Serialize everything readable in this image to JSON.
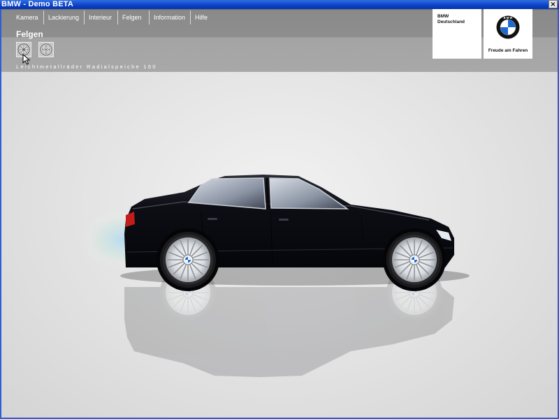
{
  "window": {
    "title": "BMW - Demo BETA",
    "close_glyph": "×"
  },
  "menu": {
    "items": [
      "Kamera",
      "Lackierung",
      "Interieur",
      "Felgen",
      "Information",
      "Hilfe"
    ]
  },
  "section": {
    "title": "Felgen"
  },
  "rims": {
    "options": [
      {
        "icon": "radial-spoke-wheel-icon",
        "selected": true
      },
      {
        "icon": "multi-spoke-wheel-icon",
        "selected": false
      }
    ],
    "caption": "Leichtmetallräder Radialspeiche 160"
  },
  "brand": {
    "dealer_name": "BMW\nDeutschland",
    "slogan": "Freude am Fahren",
    "logo_letters": "BMW",
    "colors": {
      "blue": "#1c69d4",
      "black": "#111111"
    }
  },
  "car": {
    "paint_color": "#0c0d14"
  }
}
